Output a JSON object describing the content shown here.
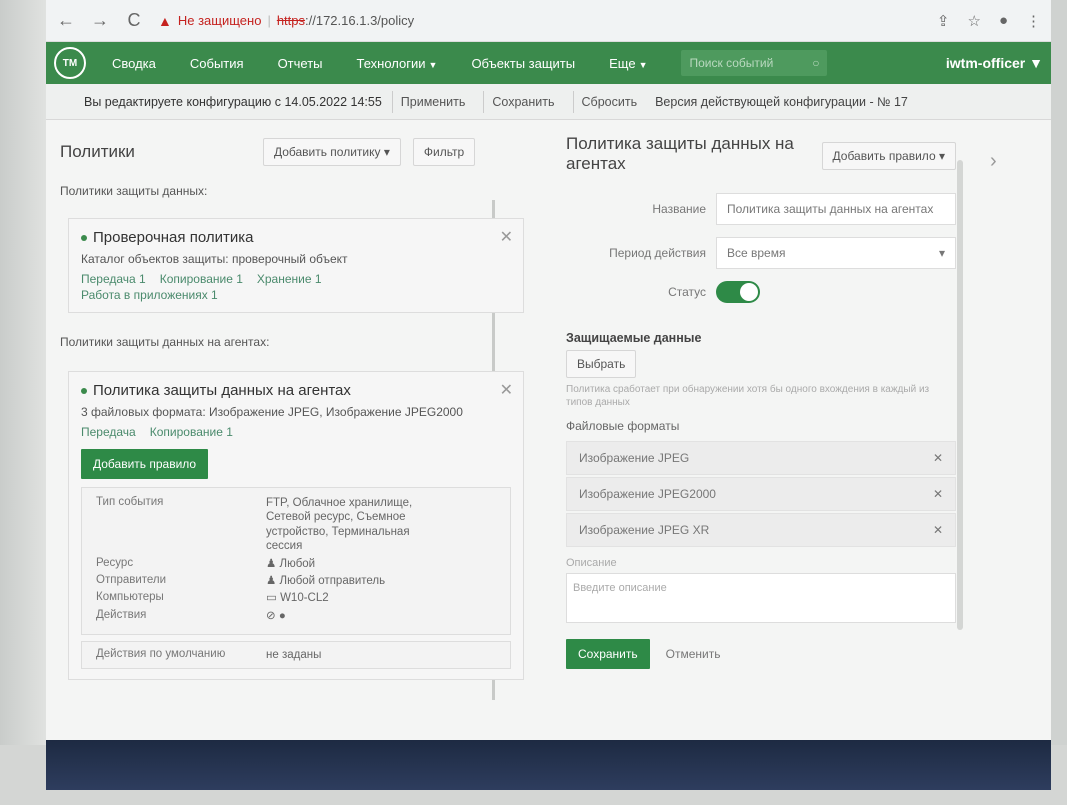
{
  "browser": {
    "nav_back": "←",
    "nav_forward": "→",
    "reload": "C",
    "security_warning": "Не защищено",
    "url_protocol": "https",
    "url_rest": "://172.16.1.3/policy",
    "icons": [
      "share-icon",
      "star-icon",
      "profile-icon",
      "menu-icon"
    ]
  },
  "nav": {
    "logo": "TM",
    "items": [
      {
        "label": "Сводка",
        "caret": false
      },
      {
        "label": "События",
        "caret": false
      },
      {
        "label": "Отчеты",
        "caret": false
      },
      {
        "label": "Технологии",
        "caret": true
      },
      {
        "label": "Объекты защиты",
        "caret": false
      },
      {
        "label": "Еще",
        "caret": true
      }
    ],
    "search_placeholder": "Поиск событий",
    "user": "iwtm-officer"
  },
  "config_bar": {
    "message": "Вы редактируете конфигурацию с 14.05.2022 14:55",
    "apply": "Применить",
    "save": "Сохранить",
    "reset": "Сбросить",
    "version": "Версия действующей конфигурации - № 17"
  },
  "left": {
    "title": "Политики",
    "add_policy": "Добавить политику",
    "filter": "Фильтр",
    "section1": "Политики защиты данных:",
    "policy1": {
      "name": "Проверочная политика",
      "desc": "Каталог объектов защиты: проверочный объект",
      "links": [
        "Передача 1",
        "Копирование 1",
        "Хранение 1",
        "Работа в приложениях 1"
      ]
    },
    "section2": "Политики защиты данных на агентах:",
    "policy2": {
      "name": "Политика защиты данных на агентах",
      "desc": "3 файловых формата: Изображение JPEG, Изображение JPEG2000",
      "links": [
        "Передача",
        "Копирование 1"
      ],
      "add_rule": "Добавить правило",
      "rule": {
        "event_type_key": "Тип события",
        "event_type_val": "FTP, Облачное хранилище, Сетевой ресурс, Съемное устройство, Терминальная сессия",
        "resource_key": "Ресурс",
        "resource_val": "Любой",
        "senders_key": "Отправители",
        "senders_val": "Любой отправитель",
        "computers_key": "Компьютеры",
        "computers_val": "W10-CL2",
        "actions_key": "Действия"
      },
      "default_key": "Действия по умолчанию",
      "default_val": "не заданы"
    }
  },
  "right": {
    "title": "Политика защиты данных на агентах",
    "add_rule": "Добавить правило",
    "name_label": "Название",
    "name_value": "Политика защиты данных на агентах",
    "period_label": "Период действия",
    "period_value": "Все время",
    "status_label": "Статус",
    "status_on": true,
    "protected_data": "Защищаемые данные",
    "choose": "Выбрать",
    "hint": "Политика сработает при обнаружении хотя бы одного вхождения в каждый из типов данных",
    "file_formats": "Файловые форматы",
    "formats": [
      "Изображение JPEG",
      "Изображение JPEG2000",
      "Изображение JPEG XR"
    ],
    "description_label": "Описание",
    "description_placeholder": "Введите описание",
    "save": "Сохранить",
    "cancel": "Отменить"
  },
  "colors": {
    "brand_green": "#3b8a4c",
    "button_green": "#2e8a47",
    "warning_red": "#c5221f"
  }
}
